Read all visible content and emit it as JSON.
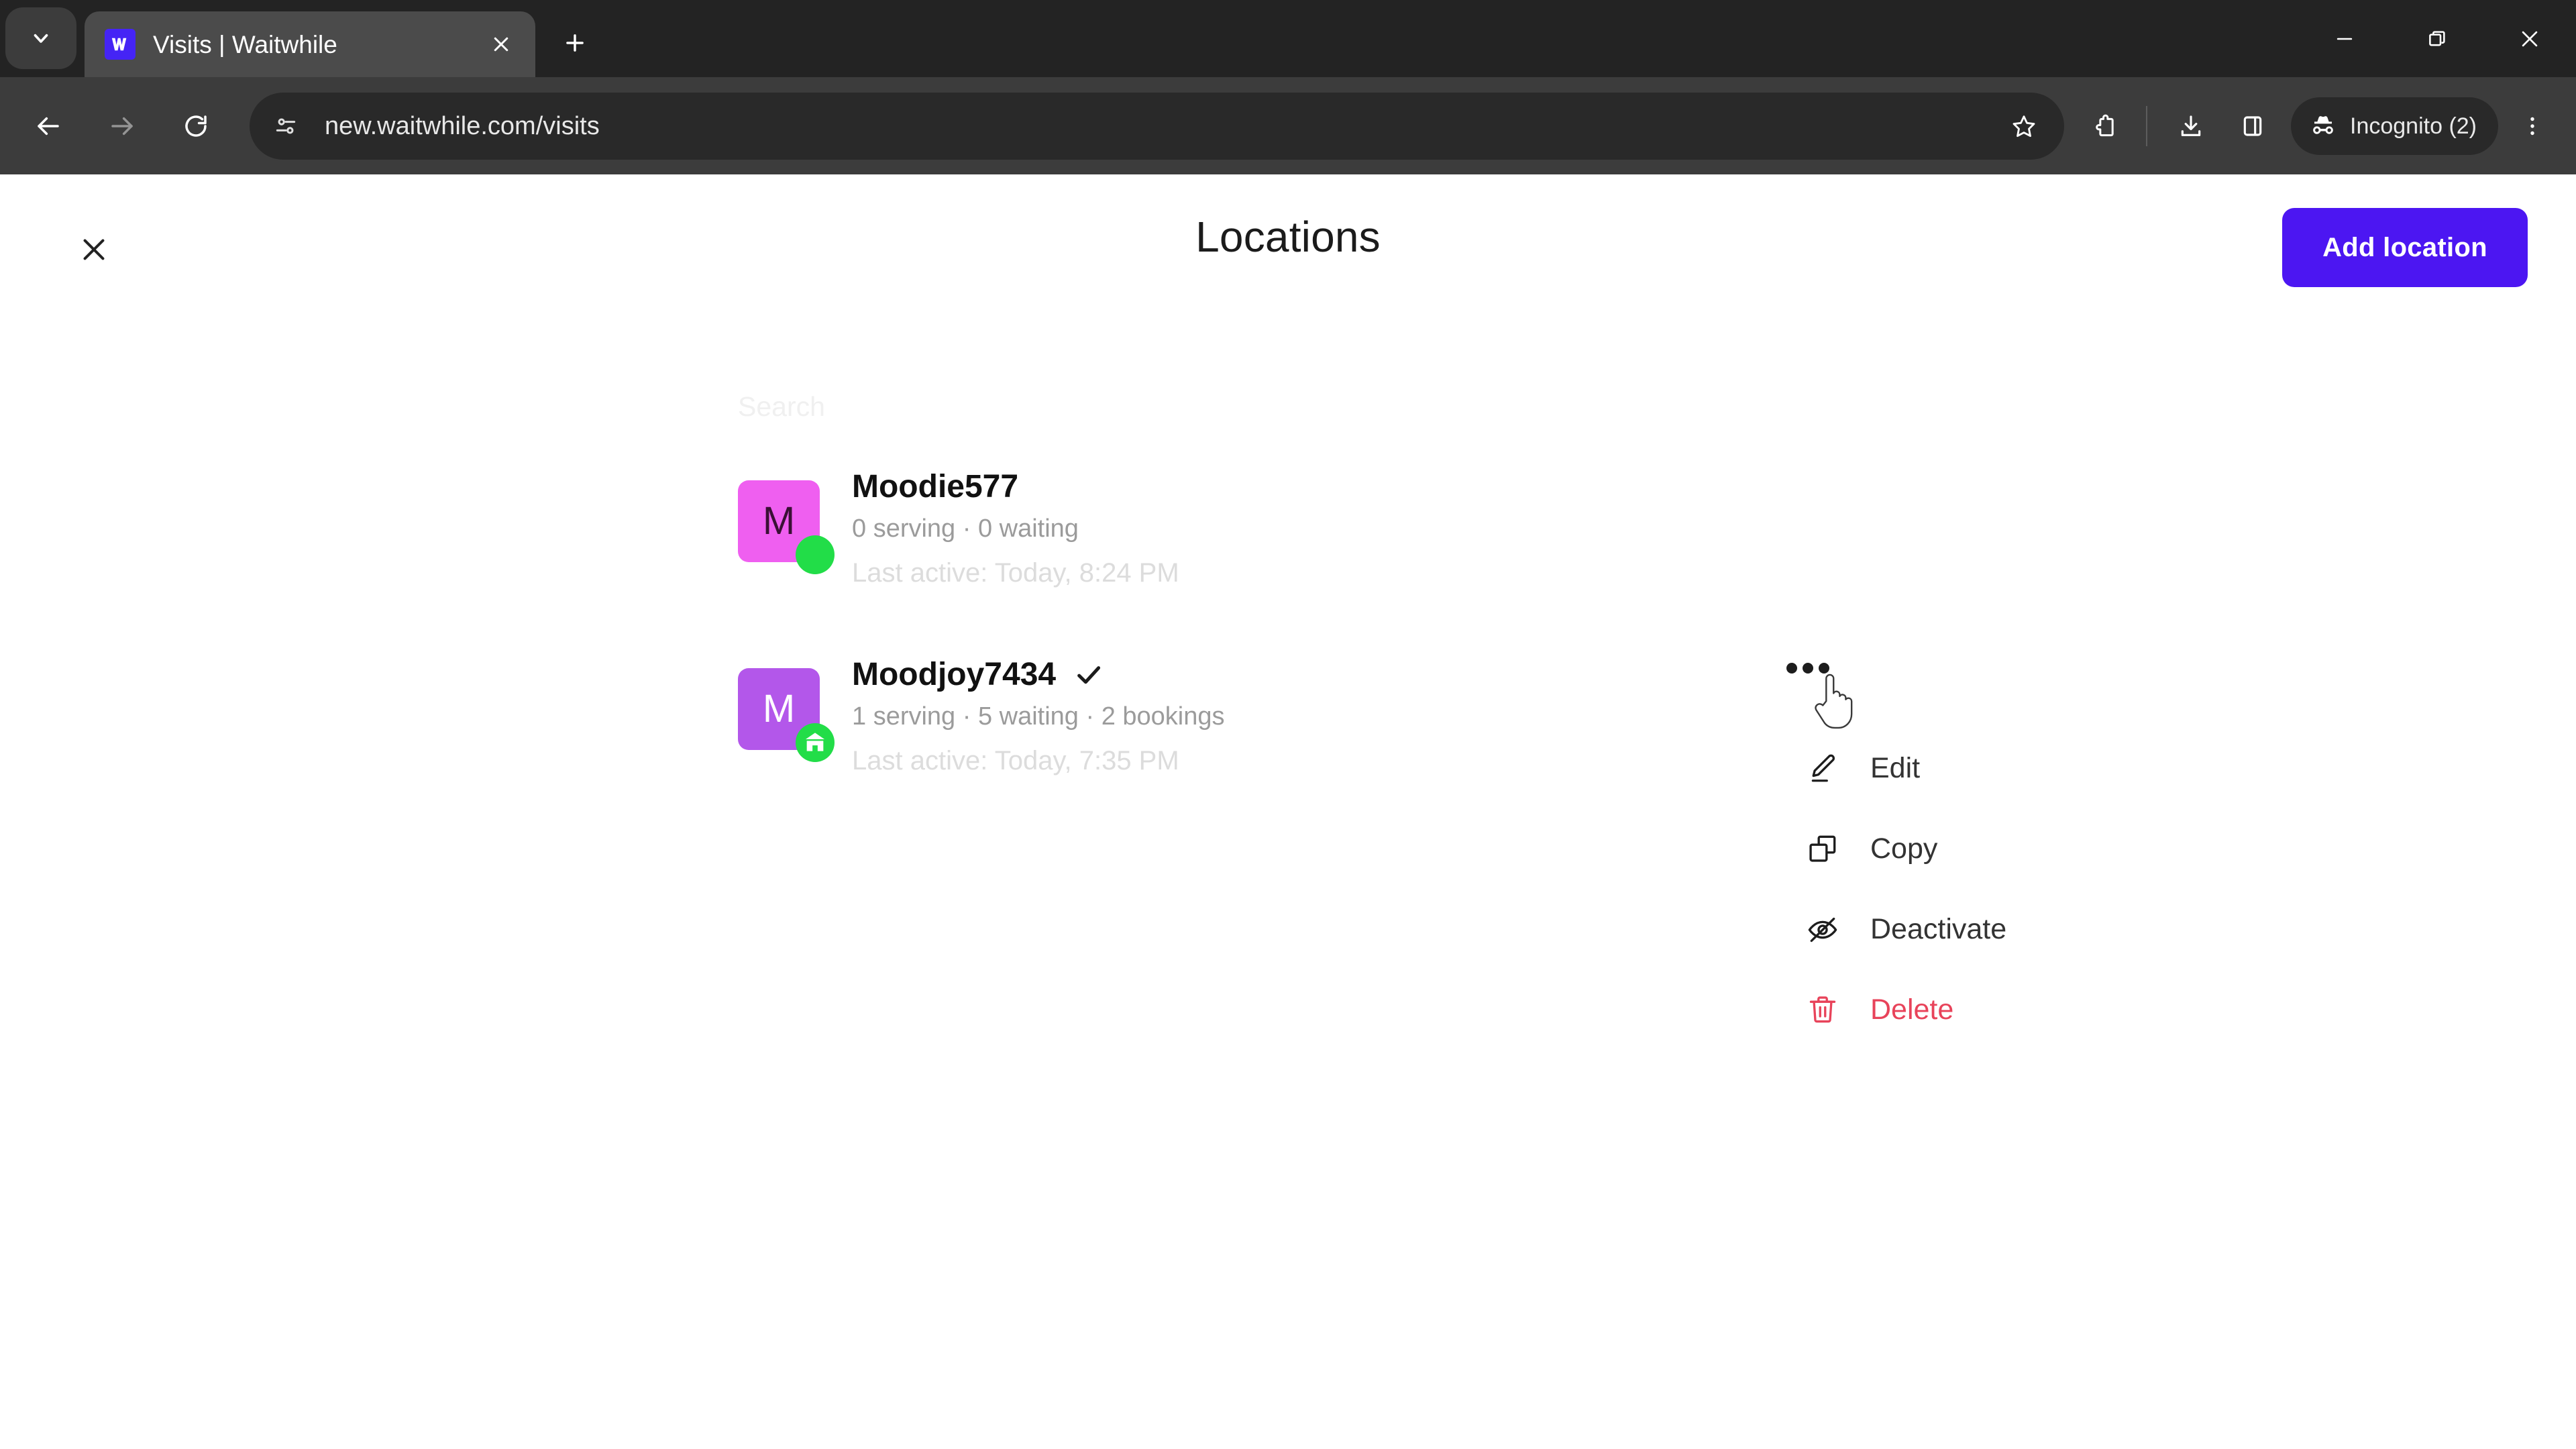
{
  "browser": {
    "tab_search_icon": "chevron-down-icon",
    "tab": {
      "favicon": "waitwhile-logo-icon",
      "title": "Visits | Waitwhile",
      "close_icon": "close-icon"
    },
    "new_tab_icon": "plus-icon",
    "window_controls": {
      "minimize_icon": "minimize-icon",
      "restore_icon": "restore-icon",
      "close_icon": "close-icon"
    },
    "toolbar": {
      "back_icon": "back-arrow-icon",
      "forward_icon": "forward-arrow-icon",
      "reload_icon": "reload-icon",
      "site_info_icon": "tune-sliders-icon",
      "url": "new.waitwhile.com/visits",
      "bookmark_icon": "star-icon",
      "extensions_icon": "extensions-puzzle-icon",
      "downloads_icon": "download-icon",
      "side_panel_icon": "side-panel-icon",
      "incognito_icon": "incognito-hat-icon",
      "incognito_label": "Incognito (2)",
      "chrome_menu_icon": "three-dots-vertical-icon"
    }
  },
  "page": {
    "close_icon": "close-icon",
    "title": "Locations",
    "add_location_label": "Add location",
    "search": {
      "placeholder": "Search",
      "value": ""
    },
    "locations": [
      {
        "avatar_letter": "M",
        "avatar_bg": "#ef5ff0",
        "avatar_fg": "#3a1035",
        "status_icon": "online-dot-icon",
        "status_color": "#22dd48",
        "name": "Moodie577",
        "selected": false,
        "stats": "0 serving · 0 waiting",
        "last_active": "Last active: Today, 8:24 PM"
      },
      {
        "avatar_letter": "M",
        "avatar_bg": "#b357ea",
        "avatar_fg": "#ffffff",
        "status_icon": "storefront-badge-icon",
        "status_color": "#22dd48",
        "name": "Moodjoy7434",
        "selected": true,
        "check_icon": "check-icon",
        "stats": "1 serving · 5 waiting · 2 bookings",
        "last_active": "Last active: Today, 7:35 PM"
      }
    ],
    "context_menu": {
      "trigger_icon": "three-dots-horizontal-icon",
      "items": [
        {
          "icon": "pencil-icon",
          "label": "Edit",
          "danger": false
        },
        {
          "icon": "copy-icon",
          "label": "Copy",
          "danger": false
        },
        {
          "icon": "eye-off-icon",
          "label": "Deactivate",
          "danger": false
        },
        {
          "icon": "trash-icon",
          "label": "Delete",
          "danger": true
        }
      ]
    },
    "cursor_icon": "pointer-hand-cursor"
  },
  "colors": {
    "brand_purple": "#4c16f2",
    "danger_red": "#e8435a",
    "online_green": "#22dd48",
    "browser_chrome": "#3c3c3c",
    "tabstrip": "#232323"
  }
}
